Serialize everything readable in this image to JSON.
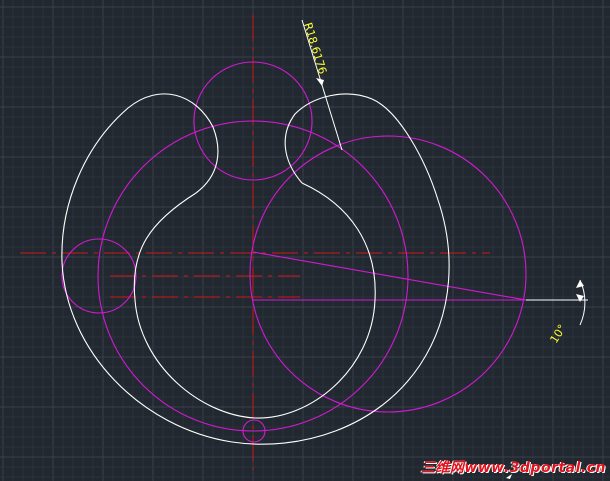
{
  "drawing": {
    "dimensions": {
      "radius_label": "R18.6176",
      "angle_label": "10°"
    },
    "colors": {
      "background": "#212830",
      "grid_minor": "#2b323c",
      "grid_major": "#39414c",
      "geometry": "#ffffff",
      "construction": "#d21ad2",
      "centerline": "#d01818",
      "dimension": "#ffff33"
    }
  },
  "watermark": {
    "text": "三维网www.3dportal.cn"
  }
}
